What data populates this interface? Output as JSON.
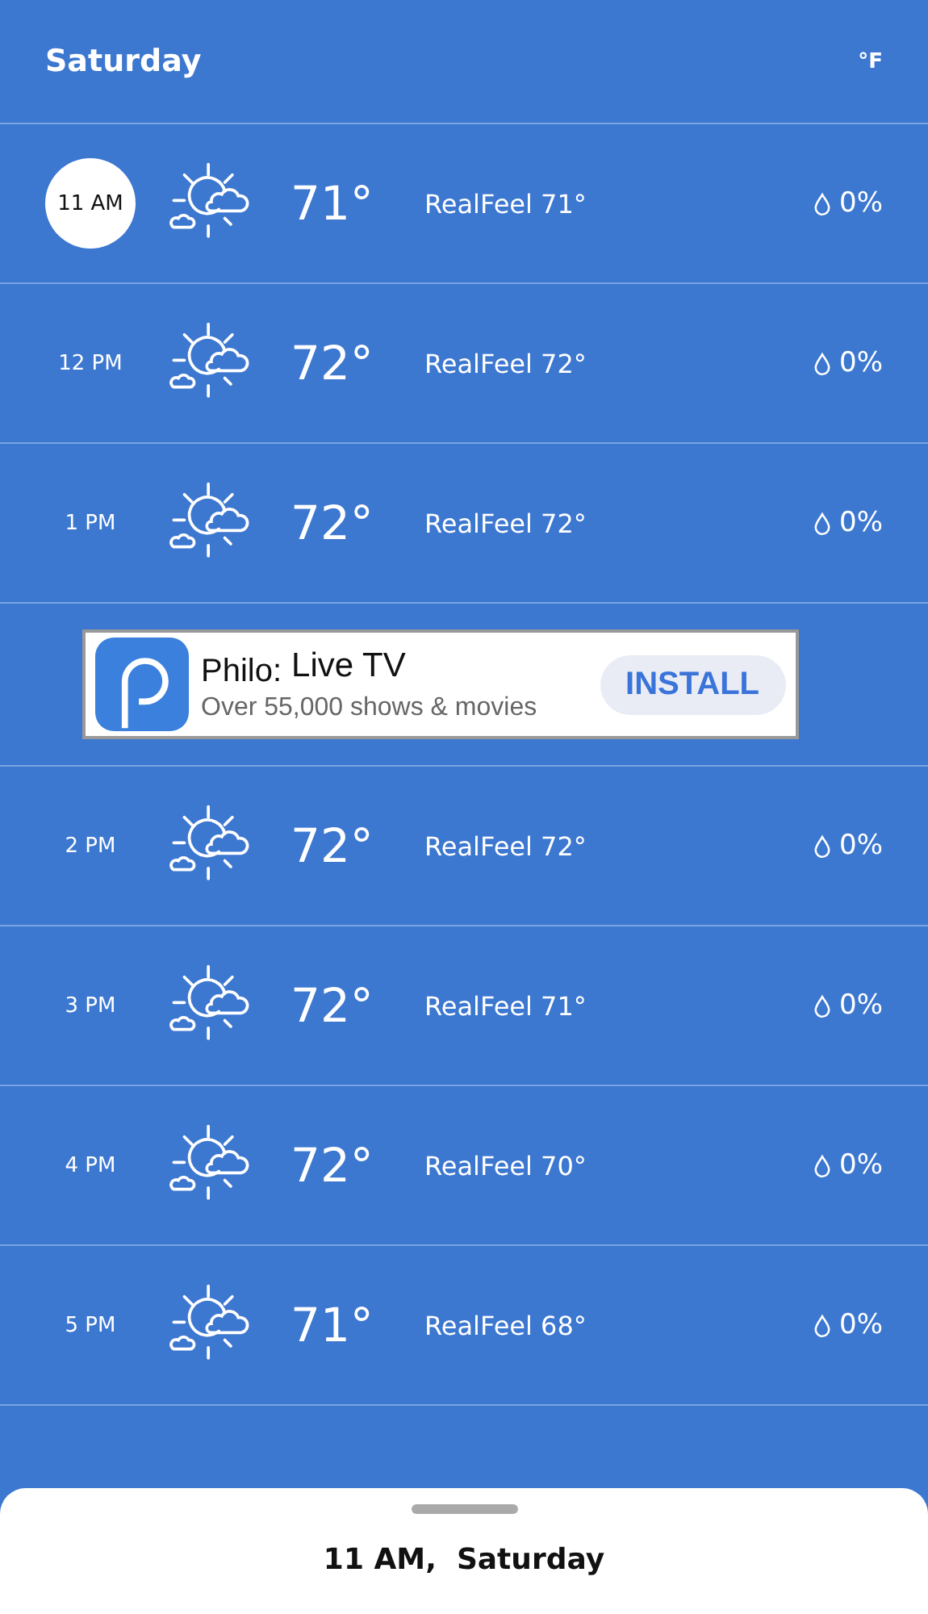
{
  "header": {
    "day": "Saturday",
    "unit": "°F"
  },
  "hours": [
    {
      "kind": "hour",
      "time": "11 AM",
      "selected": true,
      "temp": "71°",
      "realfeel": "RealFeel 71°",
      "precip": "0%"
    },
    {
      "kind": "hour",
      "time": "12 PM",
      "selected": false,
      "temp": "72°",
      "realfeel": "RealFeel 72°",
      "precip": "0%"
    },
    {
      "kind": "hour",
      "time": "1 PM",
      "selected": false,
      "temp": "72°",
      "realfeel": "RealFeel 72°",
      "precip": "0%"
    },
    {
      "kind": "ad",
      "title": "Philo:",
      "subtitle_head": "Live TV",
      "description": "Over 55,000 shows & movies",
      "button": "INSTALL"
    },
    {
      "kind": "hour",
      "time": "2 PM",
      "selected": false,
      "temp": "72°",
      "realfeel": "RealFeel 72°",
      "precip": "0%"
    },
    {
      "kind": "hour",
      "time": "3 PM",
      "selected": false,
      "temp": "72°",
      "realfeel": "RealFeel 71°",
      "precip": "0%"
    },
    {
      "kind": "hour",
      "time": "4 PM",
      "selected": false,
      "temp": "72°",
      "realfeel": "RealFeel 70°",
      "precip": "0%"
    },
    {
      "kind": "hour",
      "time": "5 PM",
      "selected": false,
      "temp": "71°",
      "realfeel": "RealFeel 68°",
      "precip": "0%"
    }
  ],
  "sheet": {
    "label": "11 AM,  Saturday"
  }
}
